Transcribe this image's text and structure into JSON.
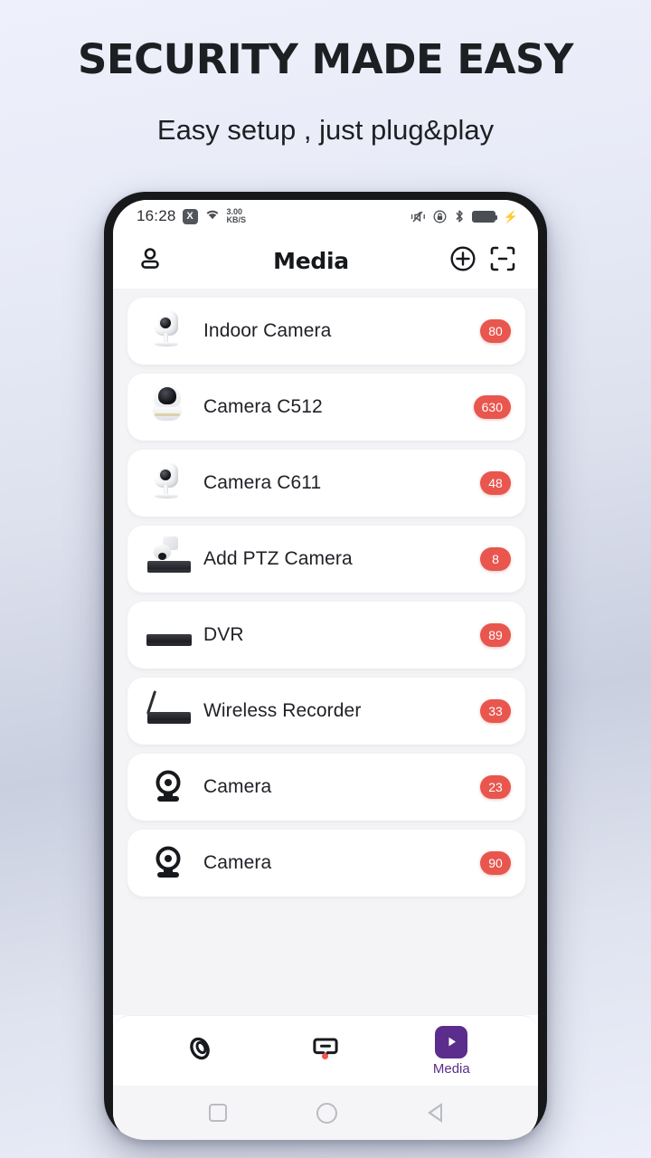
{
  "promo": {
    "title": "SECURITY MADE EASY",
    "subtitle": "Easy setup , just plug&play"
  },
  "colors": {
    "badge": "#e8564e",
    "accent": "#5b2d8c",
    "background_top": "#eef0fb",
    "background_mid": "#c9cfdf"
  },
  "status_bar": {
    "time": "16:28",
    "x_badge": "X",
    "net_speed_value": "3.00",
    "net_speed_unit": "KB/S",
    "icons": [
      "wifi-icon",
      "vibrate-mute-icon",
      "lock-icon",
      "bluetooth-icon",
      "battery-charging-icon"
    ]
  },
  "app_bar": {
    "title": "Media",
    "left_icon": "profile-icon",
    "actions": [
      "add-circle-icon",
      "scan-qr-icon"
    ]
  },
  "devices": [
    {
      "name": "Indoor Camera",
      "badge": "80",
      "thumb": "indoor-camera-photo"
    },
    {
      "name": "Camera C512",
      "badge": "630",
      "thumb": "ptz-dome-camera-photo"
    },
    {
      "name": "Camera C611",
      "badge": "48",
      "thumb": "indoor-camera-photo"
    },
    {
      "name": "Add PTZ Camera",
      "badge": "8",
      "thumb": "ptz-with-dvr-photo"
    },
    {
      "name": "DVR",
      "badge": "89",
      "thumb": "dvr-photo"
    },
    {
      "name": "Wireless Recorder",
      "badge": "33",
      "thumb": "wireless-recorder-photo"
    },
    {
      "name": "Camera",
      "badge": "23",
      "thumb": "security-camera-glyph"
    },
    {
      "name": "Camera",
      "badge": "90",
      "thumb": "security-camera-glyph"
    }
  ],
  "bottom_nav": [
    {
      "label": "",
      "icon": "spiral-eye-icon",
      "active": false,
      "dot": false
    },
    {
      "label": "",
      "icon": "chat-bubble-minus-icon",
      "active": false,
      "dot": true
    },
    {
      "label": "Media",
      "icon": "play-icon",
      "active": true,
      "dot": false
    }
  ],
  "system_nav": {
    "recents": "square-icon",
    "home": "circle-icon",
    "back": "triangle-back-icon"
  }
}
